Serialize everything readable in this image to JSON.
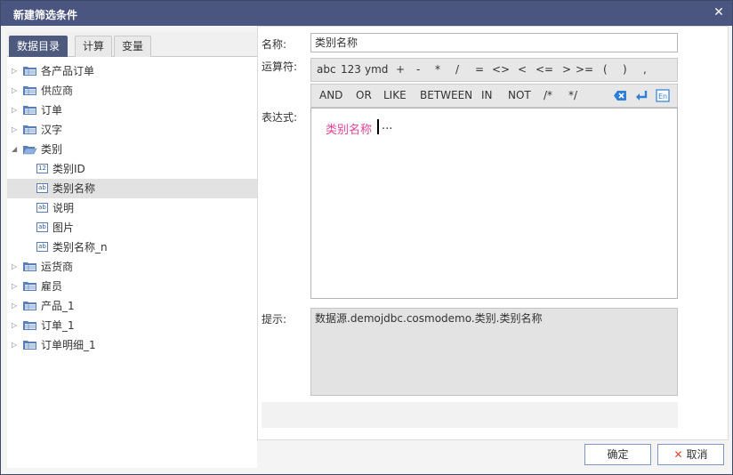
{
  "dialog": {
    "title": "新建筛选条件",
    "close_icon": "close-icon"
  },
  "tabs": [
    {
      "label": "数据目录",
      "active": true
    },
    {
      "label": "计算",
      "active": false
    },
    {
      "label": "变量",
      "active": false
    }
  ],
  "tree": {
    "nodes": [
      {
        "label": "各产品订单",
        "type": "folder",
        "expanded": false
      },
      {
        "label": "供应商",
        "type": "folder",
        "expanded": false
      },
      {
        "label": "订单",
        "type": "folder",
        "expanded": false
      },
      {
        "label": "汉字",
        "type": "folder",
        "expanded": false
      },
      {
        "label": "类别",
        "type": "folder",
        "expanded": true
      },
      {
        "label": "类别ID",
        "type": "field",
        "icon": "12"
      },
      {
        "label": "类别名称",
        "type": "field",
        "icon": "ab",
        "selected": true
      },
      {
        "label": "说明",
        "type": "field",
        "icon": "ab"
      },
      {
        "label": "图片",
        "type": "field",
        "icon": "ab"
      },
      {
        "label": "类别名称_n",
        "type": "field",
        "icon": "ab"
      },
      {
        "label": "运货商",
        "type": "folder",
        "expanded": false
      },
      {
        "label": "雇员",
        "type": "folder",
        "expanded": false
      },
      {
        "label": "产品_1",
        "type": "folder",
        "expanded": false
      },
      {
        "label": "订单_1",
        "type": "folder",
        "expanded": false
      },
      {
        "label": "订单明细_1",
        "type": "folder",
        "expanded": false
      }
    ]
  },
  "form": {
    "name_label": "名称:",
    "name_value": "类别名称",
    "operator_label": "运算符:",
    "expression_label": "表达式:",
    "hint_label": "提示:",
    "expression_field": "类别名称",
    "expression_suffix": "...",
    "hint_text": "数据源.demojdbc.cosmodemo.类别.类别名称"
  },
  "operators_row1": [
    "abc",
    "123",
    "ymd",
    "+",
    "-",
    "*",
    "/",
    "=",
    "<>",
    "<",
    "<=",
    ">",
    ">=",
    "(",
    ")",
    ","
  ],
  "operators_row2": [
    "AND",
    "OR",
    "LIKE",
    "BETWEEN",
    "IN",
    "NOT",
    "/*",
    "*/"
  ],
  "toolbar_icons": [
    "clear-icon",
    "enter-icon",
    "english-icon"
  ],
  "buttons": {
    "ok": "确定",
    "cancel": "取消"
  },
  "colors": {
    "titlebar": "#4a5580",
    "active_tab": "#4e5a7d",
    "expression_field": "#e0439a",
    "button_border": "#7e97c4"
  }
}
